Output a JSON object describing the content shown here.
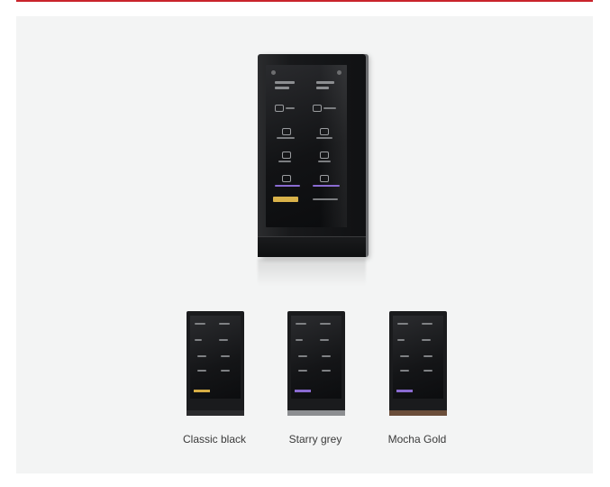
{
  "variants": [
    {
      "label": "Classic black",
      "frame_color": "#2a2a2c"
    },
    {
      "label": "Starry grey",
      "frame_color": "#8c8e91"
    },
    {
      "label": "Mocha Gold",
      "frame_color": "#6b4e3a"
    }
  ],
  "colors": {
    "top_rule": "#c9242b",
    "panel_bg": "#f3f4f4",
    "accent_button": "#d9b24a"
  }
}
